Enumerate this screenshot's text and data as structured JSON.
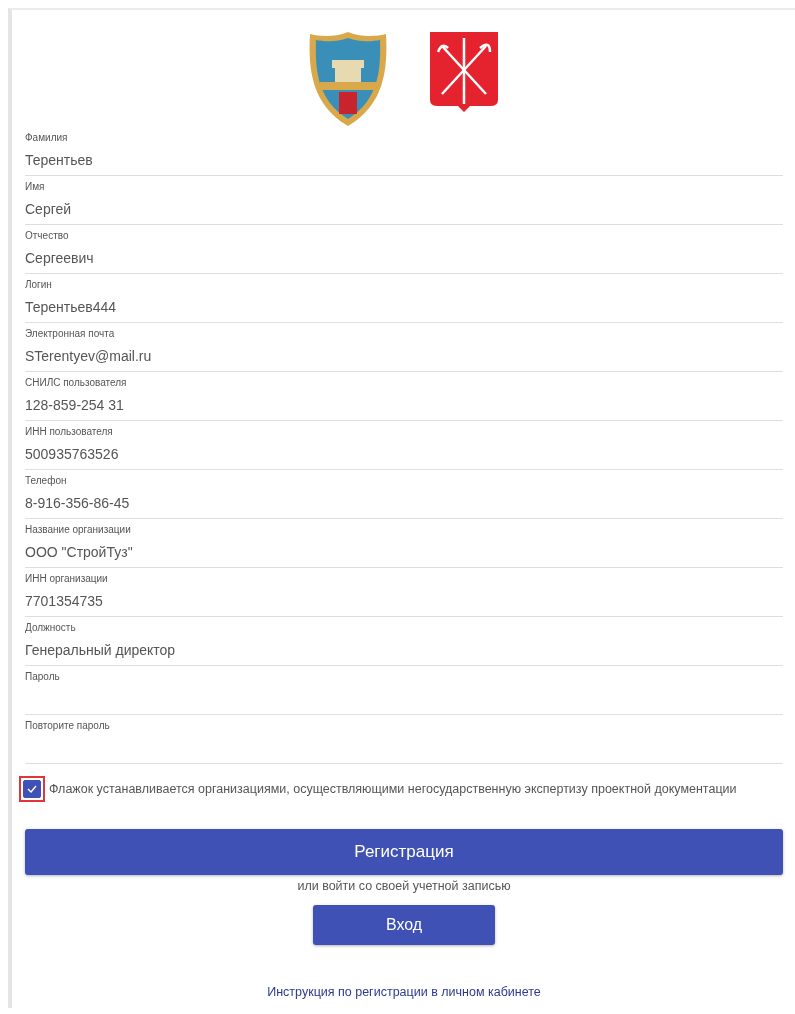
{
  "fields": [
    {
      "label": "Фамилия",
      "value": "Терентьев"
    },
    {
      "label": "Имя",
      "value": "Сергей"
    },
    {
      "label": "Отчество",
      "value": "Сергеевич"
    },
    {
      "label": "Логин",
      "value": "Терентьев444"
    },
    {
      "label": "Электронная почта",
      "value": "STerentyev@mail.ru"
    },
    {
      "label": "СНИЛС пользователя",
      "value": "128-859-254 31"
    },
    {
      "label": "ИНН пользователя",
      "value": "500935763526"
    },
    {
      "label": "Телефон",
      "value": "8-916-356-86-45"
    },
    {
      "label": "Название организации",
      "value": "ООО \"СтройТуз\""
    },
    {
      "label": "ИНН организации",
      "value": "7701354735"
    },
    {
      "label": "Должность",
      "value": "Генеральный директор"
    },
    {
      "label": "Пароль"
    },
    {
      "label": "Повторите пароль"
    }
  ],
  "expertise_checkbox": {
    "label": "Флажок устанавливается организациями, осуществляющими негосударственную экспертизу проектной документации",
    "checked": true
  },
  "register_button": "Регистрация",
  "login_hint": "или войти со своей учетной записью",
  "login_button": "Вход",
  "instruction_link": "Инструкция по регистрации в личном кабинете"
}
